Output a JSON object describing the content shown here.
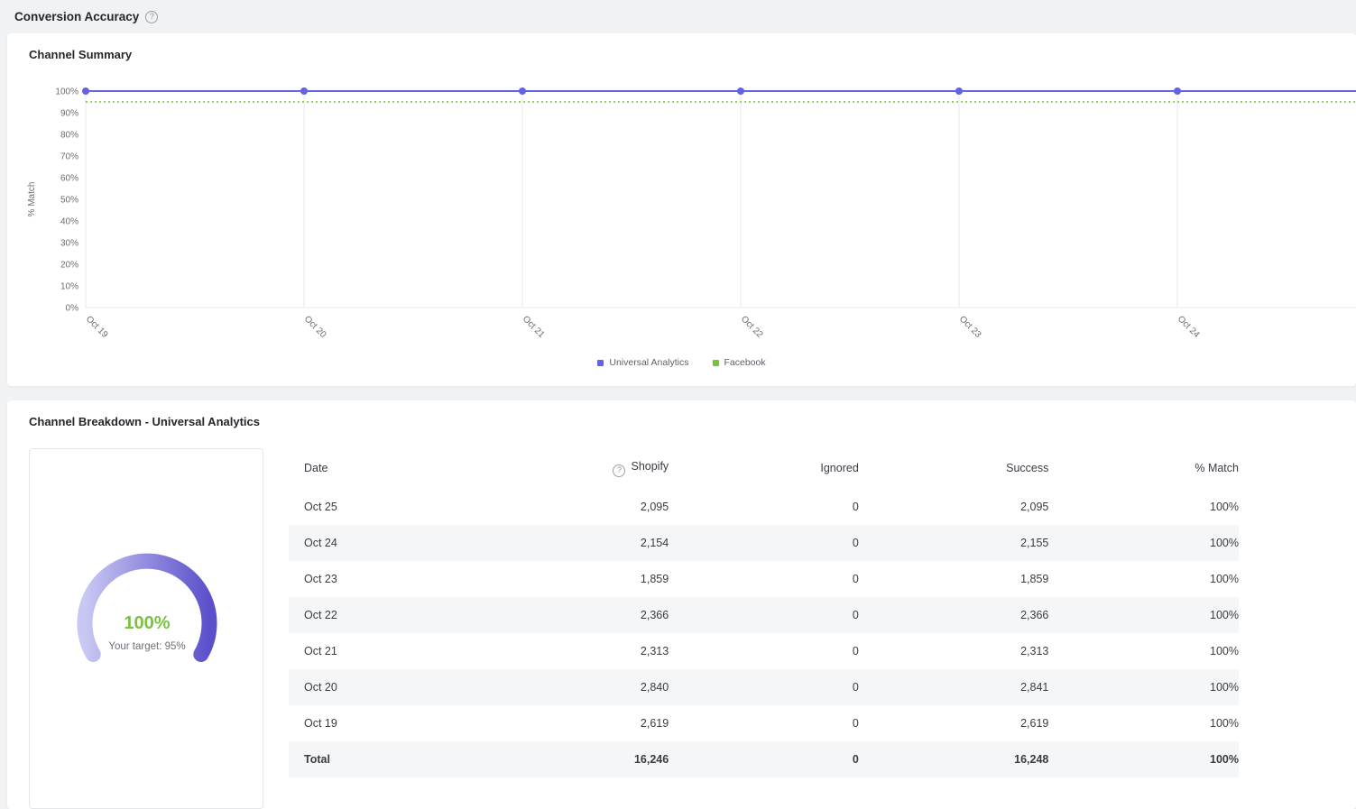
{
  "page": {
    "title": "Conversion Accuracy",
    "help_icon": "?"
  },
  "channel_summary": {
    "title": "Channel Summary",
    "chart_data": {
      "type": "line",
      "title": "Channel Summary",
      "x": [
        "Oct 19",
        "Oct 20",
        "Oct 21",
        "Oct 22",
        "Oct 23",
        "Oct 24"
      ],
      "series": [
        {
          "name": "Universal Analytics",
          "color": "#6461e3",
          "style": "solid",
          "points": true,
          "values": [
            100,
            100,
            100,
            100,
            100,
            100
          ]
        },
        {
          "name": "Facebook",
          "color": "#7ac142",
          "style": "dashed",
          "points": false,
          "values": [
            95,
            95,
            95,
            95,
            95,
            95
          ]
        }
      ],
      "xlabel": "",
      "ylabel": "% Match",
      "ylim": [
        0,
        100
      ],
      "yticks": [
        "100%",
        "90%",
        "80%",
        "70%",
        "60%",
        "50%",
        "40%",
        "30%",
        "20%",
        "10%",
        "0%"
      ],
      "grid": "vertical",
      "legend_position": "bottom"
    }
  },
  "breakdown": {
    "title": "Channel Breakdown - Universal Analytics",
    "gauge": {
      "type": "gauge",
      "value": "100%",
      "value_number": 100,
      "target_label": "Your target: 95%",
      "target_number": 95,
      "value_color": "#7ac142",
      "arc_color_start": "#c9c7f3",
      "arc_color_end": "#5b50ca"
    },
    "table": {
      "columns": [
        "Date",
        "Shopify",
        "Ignored",
        "Success",
        "% Match"
      ],
      "shopify_info_icon": "?",
      "rows": [
        [
          "Oct 25",
          "2,095",
          "0",
          "2,095",
          "100%"
        ],
        [
          "Oct 24",
          "2,154",
          "0",
          "2,155",
          "100%"
        ],
        [
          "Oct 23",
          "1,859",
          "0",
          "1,859",
          "100%"
        ],
        [
          "Oct 22",
          "2,366",
          "0",
          "2,366",
          "100%"
        ],
        [
          "Oct 21",
          "2,313",
          "0",
          "2,313",
          "100%"
        ],
        [
          "Oct 20",
          "2,840",
          "0",
          "2,841",
          "100%"
        ],
        [
          "Oct 19",
          "2,619",
          "0",
          "2,619",
          "100%"
        ]
      ],
      "total_row": [
        "Total",
        "16,246",
        "0",
        "16,248",
        "100%"
      ]
    }
  }
}
